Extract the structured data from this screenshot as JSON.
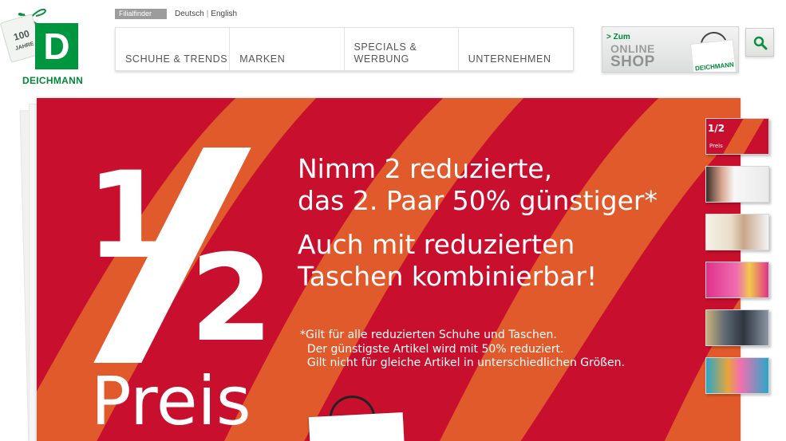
{
  "brand": {
    "name": "DEICHMANN",
    "logo_letter": "D",
    "anniversary": "100",
    "anniversary_sub": "JAHRE",
    "green": "#00963f"
  },
  "topbar": {
    "filialfinder": "Filialfinder",
    "languages": [
      "Deutsch",
      "English"
    ]
  },
  "nav": {
    "items": [
      {
        "label": "SCHUHE & TRENDS"
      },
      {
        "label": "MARKEN"
      },
      {
        "label": "SPECIALS &\nWERBUNG"
      },
      {
        "label": "UNTERNEHMEN"
      }
    ]
  },
  "online_shop": {
    "prefix": "> Zum",
    "line1": "ONLINE",
    "line2": "SHOP",
    "bag_brand": "DEICHMANN"
  },
  "search": {
    "icon": "search-icon"
  },
  "banner": {
    "colors": {
      "red": "#c8102e",
      "orange": "#e05a2b"
    },
    "big_one": "1",
    "big_two": "2",
    "preis": "Preis",
    "headline1": "Nimm 2 reduzierte,\ndas 2. Paar 50% günstiger*",
    "headline2": "Auch mit reduzierten\nTaschen kombinierbar!",
    "footnote": [
      "*Gilt für alle reduzierten Schuhe und Taschen.",
      "  Der günstigste Artikel wird mit 50% reduziert.",
      "  Gilt nicht für gleiche Artikel in unterschiedlichen Größen."
    ]
  },
  "thumbnails": [
    {
      "name": "half-price",
      "label": "1/2",
      "sub": "Preis",
      "color": "#c8102e"
    },
    {
      "name": "promo-women",
      "color": "#f2f2f2"
    },
    {
      "name": "gewinne",
      "color": "#f4f4f4"
    },
    {
      "name": "reduziert-pink",
      "color": "#e0318a"
    },
    {
      "name": "sneakers",
      "color": "#4a5560"
    },
    {
      "name": "kids",
      "color": "#2aa7c9"
    }
  ]
}
